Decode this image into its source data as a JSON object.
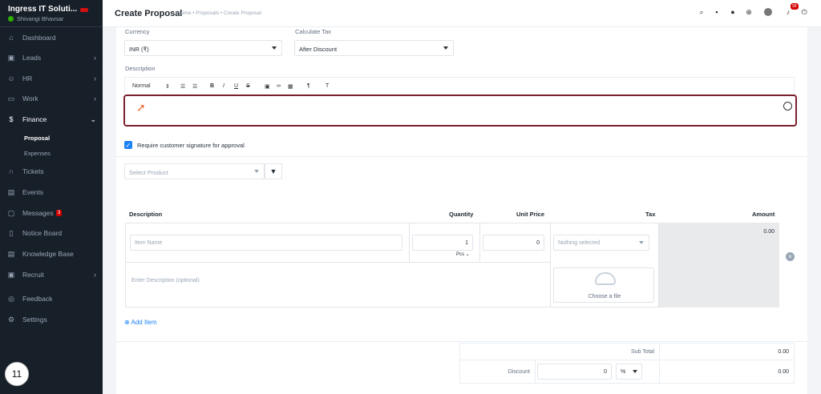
{
  "sidebar": {
    "company": "Ingress IT Soluti...",
    "user": "Shivangi Bhavsar",
    "items": [
      {
        "label": "Dashboard",
        "icon": "dashboard-icon"
      },
      {
        "label": "Leads",
        "icon": "leads-icon"
      },
      {
        "label": "HR",
        "icon": "hr-icon"
      },
      {
        "label": "Work",
        "icon": "work-icon"
      },
      {
        "label": "Finance",
        "icon": "dollar-icon"
      },
      {
        "label": "Tickets",
        "icon": "headset-icon"
      },
      {
        "label": "Events",
        "icon": "calendar-icon"
      },
      {
        "label": "Messages",
        "icon": "message-icon",
        "badge": "3"
      },
      {
        "label": "Notice Board",
        "icon": "notice-icon"
      },
      {
        "label": "Knowledge Base",
        "icon": "knowledge-icon"
      },
      {
        "label": "Recruit",
        "icon": "recruit-icon"
      },
      {
        "label": "Feedback",
        "icon": "feedback-icon"
      },
      {
        "label": "Settings",
        "icon": "settings-icon"
      }
    ],
    "finance_sub": [
      "Proposal",
      "Expenses"
    ],
    "step_number": "11"
  },
  "header": {
    "title": "Create Proposal",
    "breadcrumb": "Home • Proposals • Create Proposal",
    "notification_count": "99"
  },
  "form": {
    "currency_label": "Currency",
    "currency_value": "INR (₹)",
    "tax_label": "Calculate Tax",
    "tax_value": "After Discount",
    "description_label": "Description",
    "toolbar_normal": "Normal",
    "signature_label": "Require customer signature for approval",
    "signature_checked": true,
    "product_placeholder": "Select Product"
  },
  "items_table": {
    "headers": [
      "Description",
      "Quantity",
      "Unit Price",
      "Tax",
      "Amount"
    ],
    "item_name_placeholder": "Item Name",
    "quantity": "1",
    "unit": "Pcs",
    "unit_price": "0",
    "tax_placeholder": "Nothing selected",
    "amount": "0.00",
    "description_placeholder": "Enter Description (optional)",
    "choose_file": "Choose a file",
    "add_item": "Add Item"
  },
  "totals": {
    "sub_total_label": "Sub Total",
    "sub_total_value": "0.00",
    "discount_label": "Discount",
    "discount_value": "0",
    "discount_type": "%",
    "discount_amount": "0.00"
  }
}
